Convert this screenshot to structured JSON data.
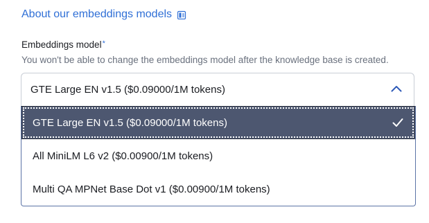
{
  "about_link": {
    "label": "About our embeddings models",
    "icon": "external-link-icon",
    "color": "#2f6fd6"
  },
  "field": {
    "label": "Embeddings model",
    "required_marker": "*",
    "help_text": "You won't be able to change the embeddings model after the knowledge base is created."
  },
  "select": {
    "value": "GTE Large EN v1.5 ($0.09000/1M tokens)",
    "expanded": true,
    "toggle_icon": "chevron-up-icon",
    "options": [
      {
        "label": "GTE Large EN v1.5 ($0.09000/1M tokens)",
        "selected": true
      },
      {
        "label": "All MiniLM L6 v2 ($0.00900/1M tokens)",
        "selected": false
      },
      {
        "label": "Multi QA MPNet Base Dot v1 ($0.00900/1M tokens)",
        "selected": false
      }
    ],
    "selected_icon": "checkmark-icon",
    "selected_bg": "#4d5770"
  }
}
